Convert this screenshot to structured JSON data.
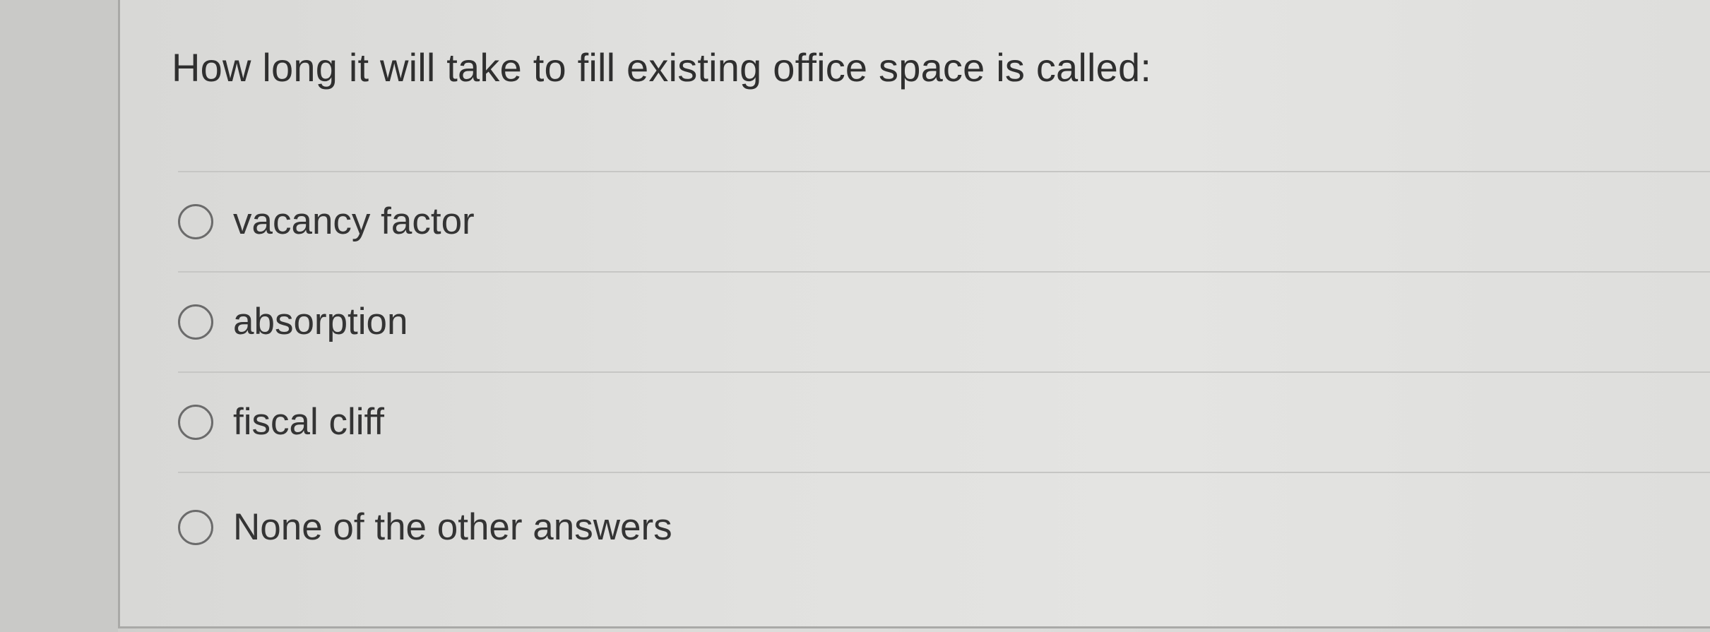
{
  "question": {
    "text": "How long it will take to fill existing office space is called:"
  },
  "answers": [
    {
      "label": "vacancy factor",
      "selected": false
    },
    {
      "label": "absorption",
      "selected": false
    },
    {
      "label": "fiscal cliff",
      "selected": false
    },
    {
      "label": "None of the other answers",
      "selected": false
    }
  ]
}
